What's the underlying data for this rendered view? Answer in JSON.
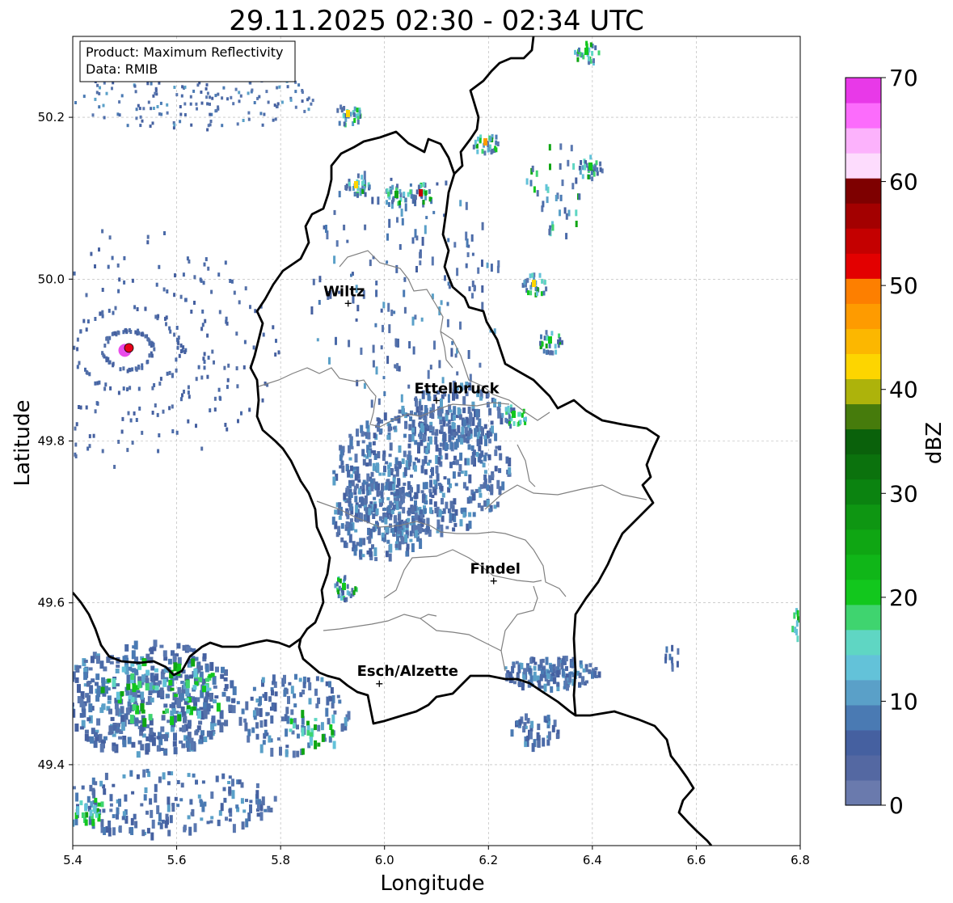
{
  "title": "29.11.2025 02:30 - 02:34 UTC",
  "info_box": {
    "line1": "Product: Maximum Reflectivity",
    "line2": "Data: RMIB"
  },
  "axes": {
    "xlabel": "Longitude",
    "ylabel": "Latitude",
    "xlim": [
      5.4,
      6.8
    ],
    "ylim": [
      49.3,
      50.3
    ],
    "xticks": [
      "5.4",
      "5.6",
      "5.8",
      "6.0",
      "6.2",
      "6.4",
      "6.6",
      "6.8"
    ],
    "yticks": [
      "49.4",
      "49.6",
      "49.8",
      "50.0",
      "50.2"
    ]
  },
  "cities": [
    {
      "name": "Wiltz",
      "lon": 5.93,
      "lat": 49.97
    },
    {
      "name": "Ettelbruck",
      "lon": 6.1,
      "lat": 49.85
    },
    {
      "name": "Findel",
      "lon": 6.21,
      "lat": 49.627
    },
    {
      "name": "Esch/Alzette",
      "lon": 5.99,
      "lat": 49.5
    }
  ],
  "radar_site": {
    "lon": 5.505,
    "lat": 49.915
  },
  "colorbar": {
    "label": "dBZ",
    "min": 0,
    "max": 70,
    "ticks": [
      "0",
      "10",
      "20",
      "30",
      "40",
      "50",
      "60",
      "70"
    ],
    "colors": [
      "#6a7aad",
      "#5468a2",
      "#4560a0",
      "#4a7ab3",
      "#5aa0c8",
      "#63c2d9",
      "#5fd6c3",
      "#3fd46f",
      "#12c71d",
      "#10b618",
      "#0fa613",
      "#0e9612",
      "#0b8310",
      "#0b720d",
      "#0a610b",
      "#467b0c",
      "#adb30b",
      "#fdd500",
      "#fcb700",
      "#fe9b00",
      "#fd7f00",
      "#e30000",
      "#c40000",
      "#a30000",
      "#7e0000",
      "#fddcfd",
      "#fcb2fc",
      "#fc6cfc",
      "#e839e8"
    ]
  },
  "colors": {
    "border": "#000000",
    "district": "#808080",
    "grid": "#b0b0b0",
    "radar_dot": "#e8001a"
  }
}
